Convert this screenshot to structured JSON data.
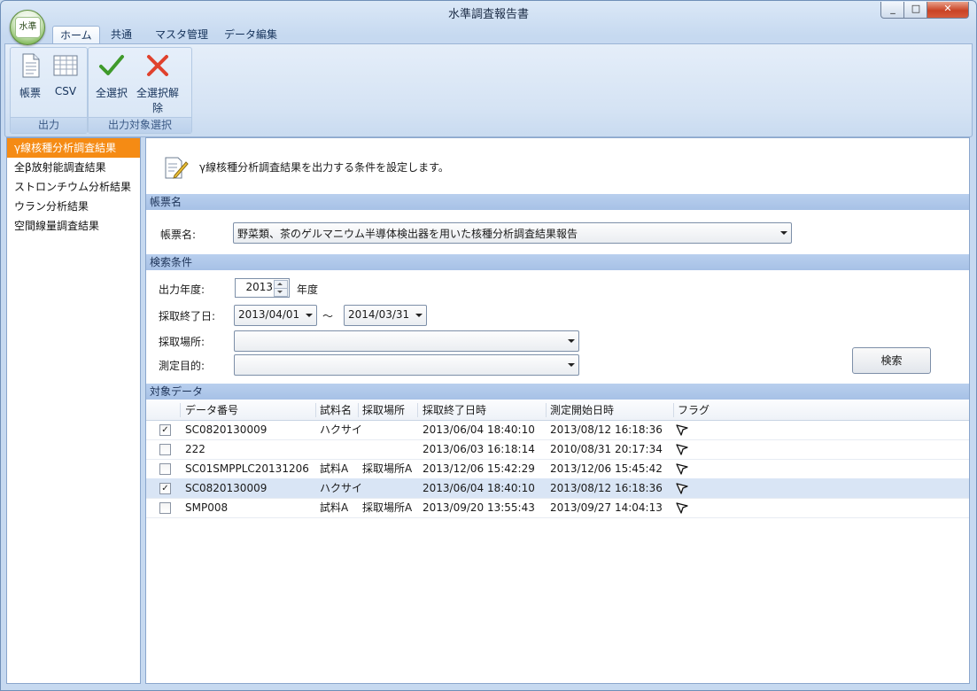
{
  "window": {
    "title": "水準調査報告書",
    "app_orb_label": "水準",
    "min_glyph": "_",
    "max_glyph": "□",
    "close_glyph": "✕"
  },
  "ribbon": {
    "tabs": [
      {
        "label": "ホーム",
        "active": true
      },
      {
        "label": "共通"
      },
      {
        "label": "マスタ管理"
      },
      {
        "label": "データ編集"
      }
    ],
    "groups": [
      {
        "label": "出力",
        "buttons": [
          {
            "label": "帳票",
            "icon": "document-icon"
          },
          {
            "label": "CSV",
            "icon": "grid-icon"
          }
        ]
      },
      {
        "label": "出力対象選択",
        "buttons": [
          {
            "label": "全選択",
            "icon": "check-icon"
          },
          {
            "label": "全選択解除",
            "icon": "x-icon"
          }
        ]
      }
    ]
  },
  "sidebar": {
    "items": [
      {
        "label": "γ線核種分析調査結果",
        "active": true
      },
      {
        "label": "全β放射能調査結果"
      },
      {
        "label": "ストロンチウム分析結果"
      },
      {
        "label": "ウラン分析結果"
      },
      {
        "label": "空間線量調査結果"
      }
    ]
  },
  "main": {
    "intro": "γ線核種分析調査結果を出力する条件を設定します。",
    "report_section": {
      "header": "帳票名",
      "label": "帳票名:",
      "value": "野菜類、茶のゲルマニウム半導体検出器を用いた核種分析調査結果報告"
    },
    "search_section": {
      "header": "検索条件",
      "year_label": "出力年度:",
      "year_value": "2013",
      "year_suffix": "年度",
      "date_label": "採取終了日:",
      "date_from": "2013/04/01",
      "date_sep": "～",
      "date_to": "2014/03/31",
      "place_label": "採取場所:",
      "place_value": "",
      "purpose_label": "測定目的:",
      "purpose_value": "",
      "search_button": "検索"
    },
    "data_section": {
      "header": "対象データ",
      "columns": [
        "データ番号",
        "試料名",
        "採取場所",
        "採取終了日時",
        "測定開始日時",
        "フラグ"
      ],
      "rows": [
        {
          "checked": true,
          "id": "SC0820130009",
          "sample": "ハクサイ",
          "place": "",
          "end": "2013/06/04 18:40:10",
          "start": "2013/08/12 16:18:36"
        },
        {
          "checked": false,
          "id": "222",
          "sample": "",
          "place": "",
          "end": "2013/06/03 16:18:14",
          "start": "2010/08/31 20:17:34"
        },
        {
          "checked": false,
          "id": "SC01SMPPLC20131206",
          "sample": "試料A",
          "place": "採取場所A",
          "end": "2013/12/06 15:42:29",
          "start": "2013/12/06 15:45:42"
        },
        {
          "checked": true,
          "id": "SC0820130009",
          "sample": "ハクサイ",
          "place": "",
          "end": "2013/06/04 18:40:10",
          "start": "2013/08/12 16:18:36",
          "selected": true
        },
        {
          "checked": false,
          "id": "SMP008",
          "sample": "試料A",
          "place": "採取場所A",
          "end": "2013/09/20 13:55:43",
          "start": "2013/09/27 14:04:13"
        }
      ]
    }
  },
  "colors": {
    "accent_orange": "#f58b14",
    "section_header": "#b9cfee",
    "ribbon_bg": "#d5e3f4"
  }
}
